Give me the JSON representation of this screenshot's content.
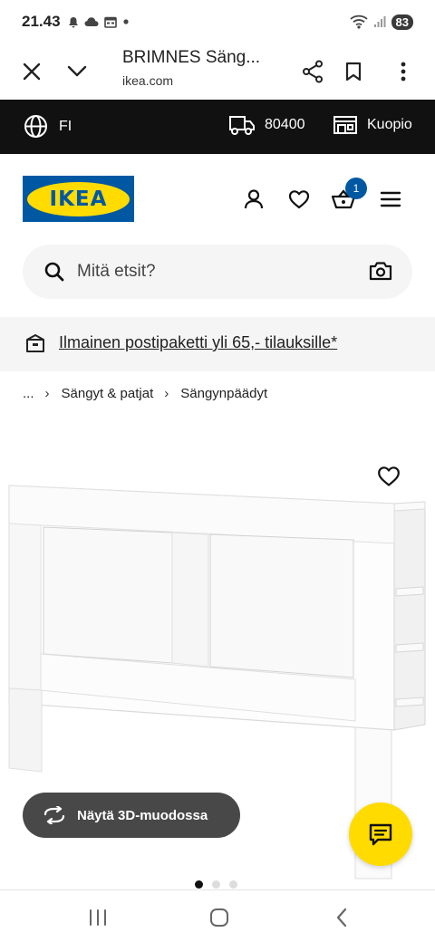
{
  "status_bar": {
    "time": "21.43",
    "battery": "83",
    "icons": [
      "notification-bell-icon",
      "cloud-icon",
      "calendar-icon",
      "dot-icon",
      "wifi-icon",
      "signal-icon"
    ]
  },
  "browser": {
    "title": "BRIMNES Säng...",
    "url": "ikea.com",
    "icons": [
      "close-icon",
      "chevron-down-icon",
      "share-icon",
      "bookmark-icon",
      "more-vert-icon"
    ]
  },
  "top_strip": {
    "language": "FI",
    "postcode": "80400",
    "store": "Kuopio"
  },
  "header": {
    "logo_text": "IKEA",
    "cart_count": "1"
  },
  "search": {
    "placeholder": "Mitä etsit?"
  },
  "promo": {
    "text": "Ilmainen postipaketti yli 65,- tilauksille*"
  },
  "breadcrumb": {
    "items": [
      "...",
      "Sängyt & patjat",
      "Sängynpäädyt"
    ]
  },
  "product": {
    "view_3d_label": "Näytä 3D-muodossa",
    "carousel": {
      "count": 3,
      "active": 0
    }
  },
  "colors": {
    "ikea_blue": "#0058a3",
    "ikea_yellow": "#ffdb00",
    "strip_black": "#111111",
    "button_gray": "#484848"
  }
}
